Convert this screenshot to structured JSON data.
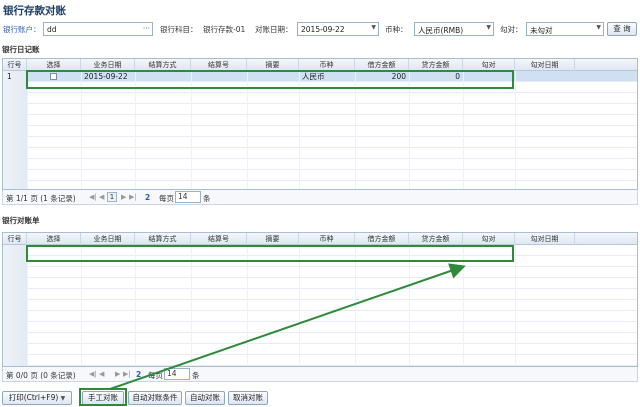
{
  "title": "银行存款对账",
  "filters": {
    "bank_account_label": "银行账户：",
    "bank_account_value": "dd",
    "bank_subject_label": "银行科目：",
    "bank_subject_value": "银行存款-01",
    "date_label": "对账日期：",
    "date_value": "2015-09-22",
    "currency_label": "币种：",
    "currency_value": "人民币(RMB)",
    "check_label": "勾对：",
    "check_value": "未勾对",
    "query_button": "查 询"
  },
  "journal": {
    "section_title": "银行日记账",
    "columns": [
      "行号",
      "选择",
      "业务日期",
      "结算方式",
      "结算号",
      "摘要",
      "币种",
      "借方金额",
      "贷方金额",
      "勾对",
      "勾对日期"
    ],
    "rows": [
      {
        "row_no": "1",
        "date": "2015-09-22",
        "settle_method": "",
        "settle_no": "",
        "summary": "",
        "currency": "人民币",
        "debit": "200",
        "credit": "0",
        "check": "",
        "check_date": ""
      }
    ],
    "pager": {
      "page_info": "第 1/1 页 (1 条记录)",
      "current_page": "1",
      "per_page_label": "每页",
      "per_page_value": "14",
      "per_page_unit": "条",
      "refresh": "2"
    }
  },
  "statement": {
    "section_title": "银行对账单",
    "columns": [
      "行号",
      "选择",
      "业务日期",
      "结算方式",
      "结算号",
      "摘要",
      "币种",
      "借方金额",
      "贷方金额",
      "勾对",
      "勾对日期"
    ],
    "pager": {
      "page_info": "第 0/0 页 (0 条记录)",
      "per_page_label": "每页",
      "per_page_value": "14",
      "per_page_unit": "条",
      "refresh": "2"
    }
  },
  "toolbar": {
    "print_button": "打印(Ctrl+F9)",
    "manual_button": "手工对账",
    "auto_condition_button": "自动对账条件",
    "auto_button": "自动对账",
    "cancel_button": "取消对账"
  },
  "colors": {
    "highlight": "#2f8a3a",
    "link": "#2a5db0",
    "selected_row": "#cfe0f3"
  }
}
